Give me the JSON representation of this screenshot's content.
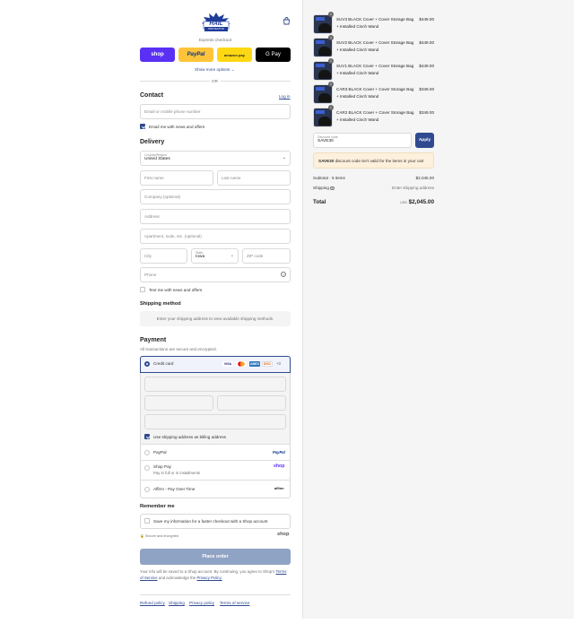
{
  "logo": {
    "line1": "HAIL",
    "line2": "PROTECTOR"
  },
  "express": {
    "label": "Express checkout",
    "shop": "shop",
    "paypal": "PayPal",
    "amazon": "amazon pay",
    "gpay": "G Pay",
    "more": "Show more options",
    "or": "OR"
  },
  "contact": {
    "title": "Contact",
    "login": "Log in",
    "email_placeholder": "Email or mobile phone number",
    "news_label": "Email me with news and offers"
  },
  "delivery": {
    "title": "Delivery",
    "country_label": "Country/Region",
    "country_value": "United States",
    "first": "First name",
    "last": "Last name",
    "company": "Company (optional)",
    "address": "Address",
    "apt": "Apartment, suite, etc. (optional)",
    "city": "City",
    "state_label": "State",
    "state_value": "Iowa",
    "zip": "ZIP code",
    "phone": "Phone",
    "text_label": "Text me with news and offers"
  },
  "shipping": {
    "title": "Shipping method",
    "note": "Enter your shipping address to view available shipping methods."
  },
  "payment": {
    "title": "Payment",
    "subtitle": "All transactions are secure and encrypted.",
    "credit_card": "Credit card",
    "cards": [
      "VISA",
      "MC",
      "AMEX",
      "DISC"
    ],
    "more_cards": "+3",
    "billing_label": "Use shipping address as billing address",
    "paypal": "PayPal",
    "paypal_logo": "PayPal",
    "shoppay": "Shop Pay",
    "shoppay_sub": "Pay in full or in installments",
    "shoppay_logo": "shop",
    "affirm": "Affirm - Pay Over Time",
    "affirm_logo": "affirm"
  },
  "remember": {
    "title": "Remember me",
    "label": "Save my information for a faster checkout with a Shop account",
    "secure": "Secure and encrypted",
    "shop": "shop"
  },
  "place_order": "Place order",
  "legal": {
    "text": "Your info will be saved to a Shop account. By continuing, you agree to Shop's",
    "terms": "Terms of Service",
    "and": "and acknowledge the",
    "privacy": "Privacy Policy."
  },
  "footer": [
    "Refund policy",
    "Shipping",
    "Privacy policy",
    "Terms of service"
  ],
  "cart": {
    "items": [
      {
        "title": "SUV3 BLACK Cover + Cover Storage Bag + Installed Cinch Wand",
        "price": "$449.00",
        "qty": "1"
      },
      {
        "title": "SUV2 BLACK Cover + Cover Storage Bag + Installed Cinch Wand",
        "price": "$449.00",
        "qty": "1"
      },
      {
        "title": "SUV1 BLACK Cover + Cover Storage Bag + Installed Cinch Wand",
        "price": "$449.00",
        "qty": "1"
      },
      {
        "title": "CAR3 BLACK Cover + Cover Storage Bag + Installed Cinch Wand",
        "price": "$349.00",
        "qty": "1"
      },
      {
        "title": "CAR2 BLACK Cover + Cover Storage Bag + Installed Cinch Wand",
        "price": "$349.00",
        "qty": "1"
      }
    ],
    "discount_label": "Discount code",
    "discount_value": "SAVE30",
    "apply": "Apply",
    "alert_code": "SAVE30",
    "alert_text": "discount code isn't valid for the items in your cart",
    "subtotal_label": "Subtotal · 5 items",
    "subtotal_value": "$2,045.00",
    "shipping_label": "Shipping",
    "shipping_value": "Enter shipping address",
    "total_label": "Total",
    "currency": "USD",
    "total_value": "$2,045.00"
  }
}
